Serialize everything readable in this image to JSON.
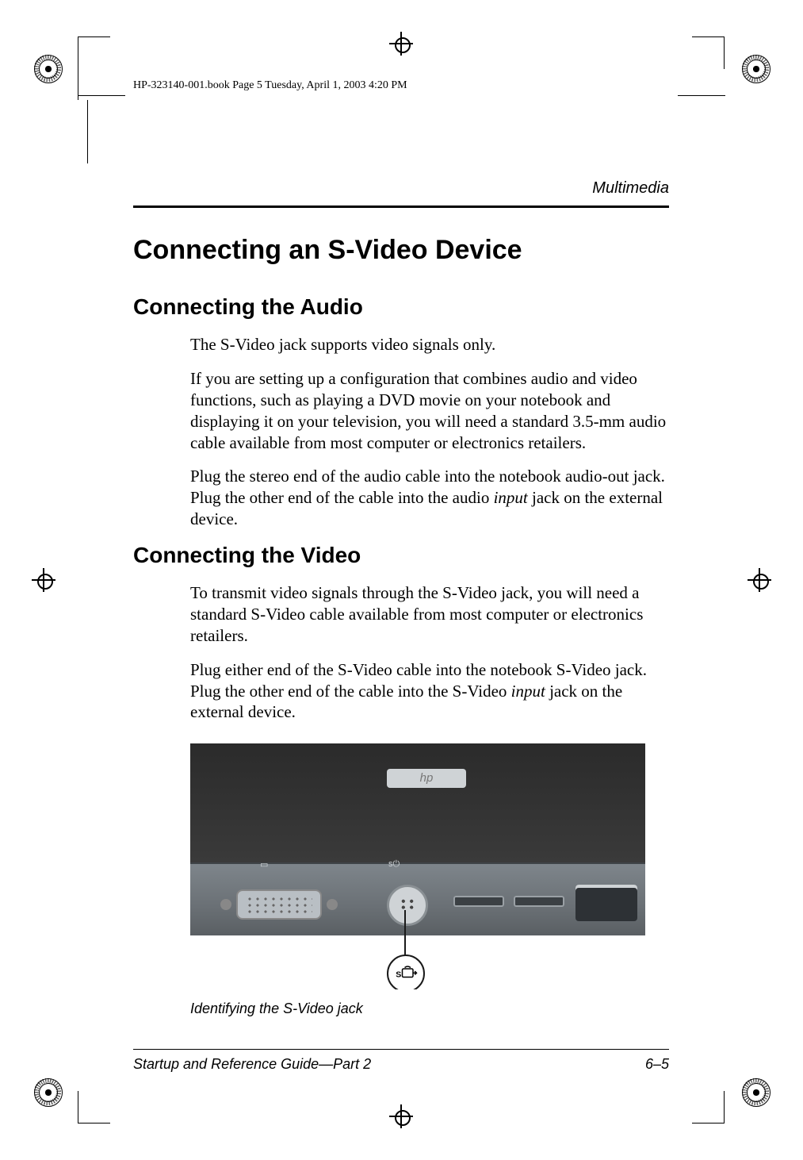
{
  "doc_header": "HP-323140-001.book  Page 5  Tuesday, April 1, 2003  4:20 PM",
  "section": "Multimedia",
  "title_h1": "Connecting an S-Video Device",
  "h2_audio": "Connecting the Audio",
  "audio_p1": "The S-Video jack supports video signals only.",
  "audio_p2a": "If you are setting up a configuration that combines audio and video functions, such as playing a DVD movie on your notebook and displaying it on your television, you will need a standard 3.5-mm audio cable available from most computer or electronics retailers.",
  "audio_p3a": "Plug the stereo end of the audio cable into the notebook audio-out jack. Plug the other end of the cable into the audio ",
  "audio_p3_em": "input",
  "audio_p3b": " jack on the external device.",
  "h2_video": "Connecting the Video",
  "video_p1": "To transmit video signals through the S-Video jack, you will need a standard S-Video cable available from most computer or electronics retailers.",
  "video_p2a": "Plug either end of the S-Video cable into the notebook S-Video jack. Plug the other end of the cable into the S-Video ",
  "video_p2_em": "input",
  "video_p2b": " jack on the external device.",
  "figure_caption": "Identifying the S-Video jack",
  "footer_left": "Startup and Reference Guide—Part 2",
  "footer_right": "6–5",
  "callout_label": "S"
}
